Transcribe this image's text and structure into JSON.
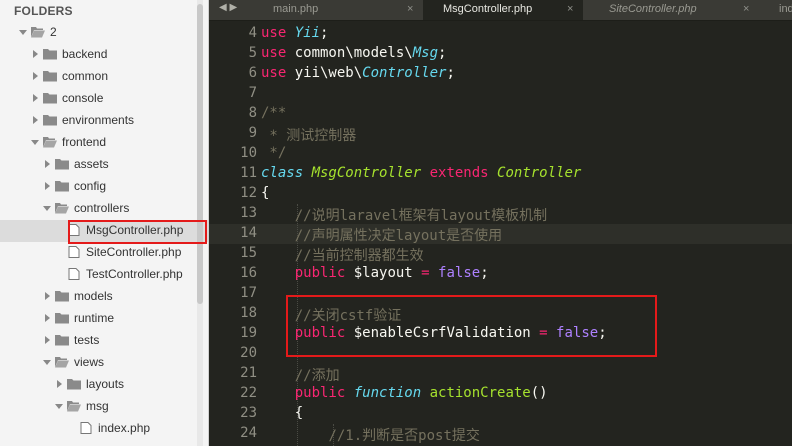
{
  "sidebar": {
    "title": "FOLDERS",
    "items": [
      {
        "label": "2",
        "depth": 0,
        "open": true
      },
      {
        "label": "backend",
        "depth": 1,
        "open": false
      },
      {
        "label": "common",
        "depth": 1,
        "open": false
      },
      {
        "label": "console",
        "depth": 1,
        "open": false
      },
      {
        "label": "environments",
        "depth": 1,
        "open": false
      },
      {
        "label": "frontend",
        "depth": 1,
        "open": true
      },
      {
        "label": "assets",
        "depth": 2,
        "open": false
      },
      {
        "label": "config",
        "depth": 2,
        "open": false
      },
      {
        "label": "controllers",
        "depth": 2,
        "open": true
      },
      {
        "label": "MsgController.php",
        "depth": 3,
        "file": true,
        "selected": true
      },
      {
        "label": "SiteController.php",
        "depth": 3,
        "file": true
      },
      {
        "label": "TestController.php",
        "depth": 3,
        "file": true
      },
      {
        "label": "models",
        "depth": 2,
        "open": false
      },
      {
        "label": "runtime",
        "depth": 2,
        "open": false
      },
      {
        "label": "tests",
        "depth": 2,
        "open": false
      },
      {
        "label": "views",
        "depth": 2,
        "open": true
      },
      {
        "label": "layouts",
        "depth": 3,
        "open": false
      },
      {
        "label": "msg",
        "depth": 3,
        "open": true
      },
      {
        "label": "index.php",
        "depth": 4,
        "file": true
      }
    ]
  },
  "tabs": [
    {
      "label": "main.php",
      "active": false
    },
    {
      "label": "MsgController.php",
      "active": true
    },
    {
      "label": "SiteController.php",
      "active": false
    },
    {
      "label": "index",
      "active": false
    }
  ],
  "tab_close_glyph": "×",
  "editor": {
    "lines": [
      {
        "n": "4",
        "t": [
          [
            "kw",
            "use "
          ],
          [
            "sy",
            "Yii"
          ],
          [
            "",
            "; "
          ]
        ]
      },
      {
        "n": "5",
        "t": [
          [
            "kw",
            "use "
          ],
          [
            "",
            "common\\models\\"
          ],
          [
            "sy",
            "Msg"
          ],
          [
            "",
            ";"
          ]
        ]
      },
      {
        "n": "6",
        "t": [
          [
            "kw",
            "use "
          ],
          [
            "",
            "yii\\web\\"
          ],
          [
            "sy",
            "Controller"
          ],
          [
            "",
            ";"
          ]
        ]
      },
      {
        "n": "7",
        "t": []
      },
      {
        "n": "8",
        "t": [
          [
            "cm",
            "/**"
          ]
        ]
      },
      {
        "n": "9",
        "t": [
          [
            "cm",
            " * 测试控制器"
          ]
        ]
      },
      {
        "n": "10",
        "t": [
          [
            "cm",
            " */"
          ]
        ]
      },
      {
        "n": "11",
        "t": [
          [
            "sy",
            "class "
          ],
          [
            "cls",
            "MsgController "
          ],
          [
            "kw",
            "extends "
          ],
          [
            "cls",
            "Controller"
          ]
        ]
      },
      {
        "n": "12",
        "t": [
          [
            "",
            "{"
          ]
        ]
      },
      {
        "n": "13",
        "t": [
          [
            "",
            "    "
          ],
          [
            "cm",
            "//说明laravel框架有layout模板机制"
          ]
        ]
      },
      {
        "n": "14",
        "t": [
          [
            "",
            "    "
          ],
          [
            "cm",
            "//声明属性决定layout是否使用"
          ]
        ]
      },
      {
        "n": "15",
        "t": [
          [
            "",
            "    "
          ],
          [
            "cm",
            "//当前控制器都生效"
          ]
        ]
      },
      {
        "n": "16",
        "t": [
          [
            "",
            "    "
          ],
          [
            "kw",
            "public "
          ],
          [
            "",
            "$layout "
          ],
          [
            "kw",
            "= "
          ],
          [
            "pp",
            "false"
          ],
          [
            "",
            ";"
          ]
        ]
      },
      {
        "n": "17",
        "t": []
      },
      {
        "n": "18",
        "t": [
          [
            "",
            "    "
          ],
          [
            "cm",
            "//关闭cstf验证"
          ]
        ]
      },
      {
        "n": "19",
        "t": [
          [
            "",
            "    "
          ],
          [
            "kw",
            "public "
          ],
          [
            "",
            "$enableCsrfValidation "
          ],
          [
            "kw",
            "= "
          ],
          [
            "pp",
            "false"
          ],
          [
            "",
            ";"
          ]
        ]
      },
      {
        "n": "20",
        "t": []
      },
      {
        "n": "21",
        "t": [
          [
            "",
            "    "
          ],
          [
            "cm",
            "//添加"
          ]
        ]
      },
      {
        "n": "22",
        "t": [
          [
            "",
            "    "
          ],
          [
            "kw",
            "public "
          ],
          [
            "sy",
            "function "
          ],
          [
            "fn",
            "actionCreate"
          ],
          [
            "",
            "()"
          ]
        ]
      },
      {
        "n": "23",
        "t": [
          [
            "",
            "    {"
          ]
        ]
      },
      {
        "n": "24",
        "t": [
          [
            "",
            "        "
          ],
          [
            "cm",
            "//1.判断是否post提交"
          ]
        ]
      }
    ]
  },
  "colors": {
    "annotation": "#e41a1a",
    "accent": "#a6e22e"
  }
}
